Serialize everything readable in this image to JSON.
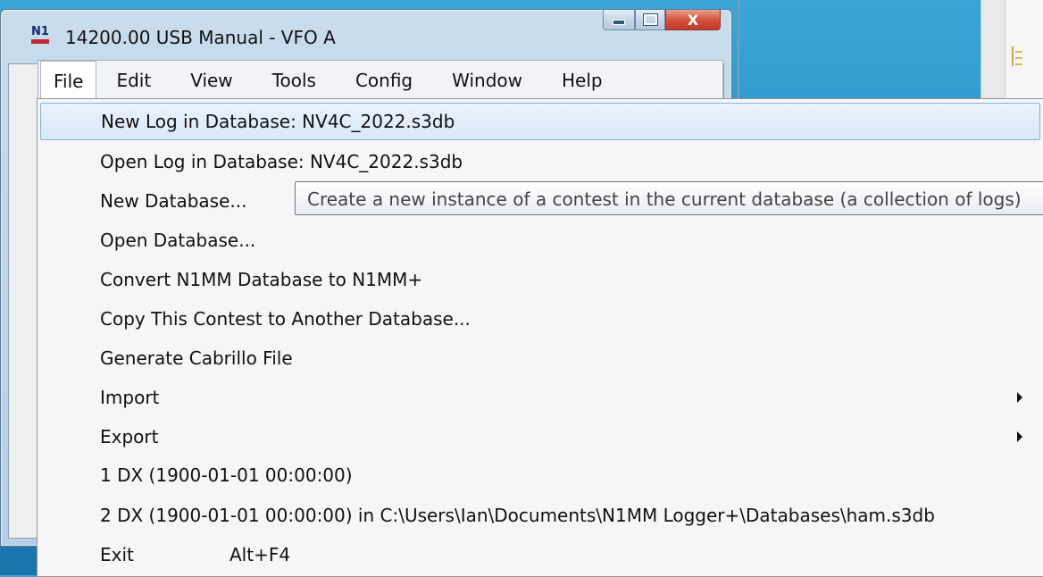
{
  "window": {
    "title": "14200.00 USB Manual - VFO A",
    "icon_label": "N1",
    "caption_buttons": {
      "minimize_icon": "minimize-icon",
      "maximize_icon": "maximize-icon",
      "close_glyph": "X"
    }
  },
  "menubar": {
    "items": [
      {
        "label": "File",
        "active": true
      },
      {
        "label": "Edit"
      },
      {
        "label": "View"
      },
      {
        "label": "Tools"
      },
      {
        "label": "Config"
      },
      {
        "label": "Window"
      },
      {
        "label": "Help"
      }
    ]
  },
  "file_menu": {
    "items": [
      {
        "label": "New Log in Database: NV4C_2022.s3db",
        "highlighted": true
      },
      {
        "label": "Open Log in Database: NV4C_2022.s3db"
      },
      {
        "label": "New Database..."
      },
      {
        "label": "Open Database..."
      },
      {
        "label": "Convert N1MM Database to N1MM+"
      },
      {
        "label": "Copy This Contest to Another Database..."
      },
      {
        "label": "Generate Cabrillo File"
      },
      {
        "label": "Import",
        "submenu": true
      },
      {
        "label": "Export",
        "submenu": true
      },
      {
        "label": "1 DX (1900-01-01 00:00:00)"
      },
      {
        "label": "2 DX (1900-01-01 00:00:00) in C:\\Users\\Ian\\Documents\\N1MM Logger+\\Databases\\ham.s3db"
      },
      {
        "label": "Exit",
        "shortcut": "Alt+F4"
      }
    ]
  },
  "tooltip": {
    "text": "Create a new instance of a contest in the current database (a collection of logs)"
  },
  "colors": {
    "desktop": "#2a95cc",
    "highlight_border": "#7fb2e5",
    "close_button": "#c1382a"
  }
}
